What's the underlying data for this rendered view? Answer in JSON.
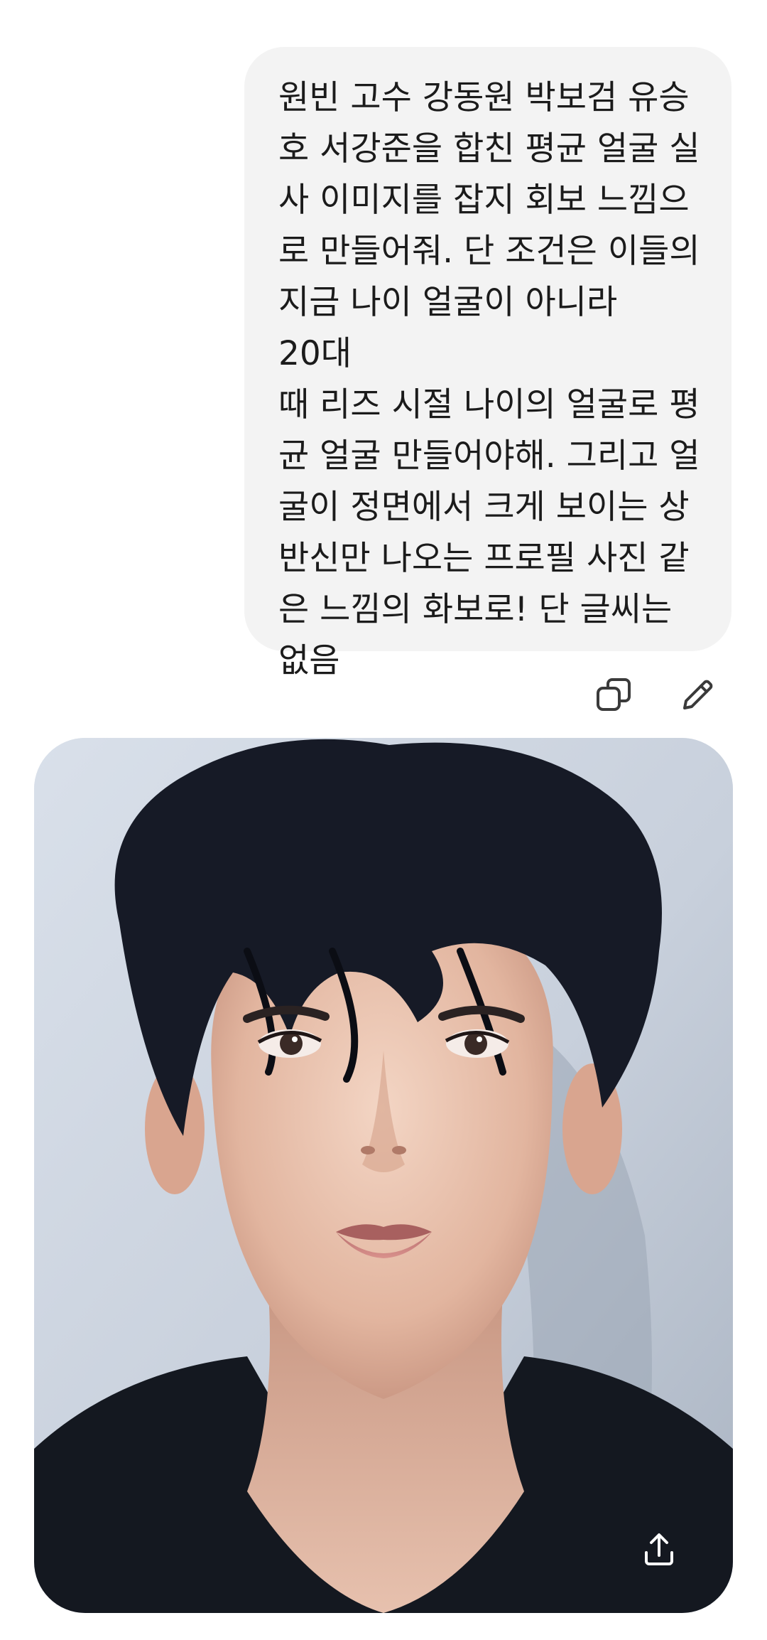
{
  "conversation": {
    "user_message": {
      "text": "원빈 고수 강동원 박보검 유승\n호 서강준을 합친 평균 얼굴 실\n사 이미지를 잡지 회보 느낌으\n로 만들어줘. 단 조건은 이들의\n지금 나이 얼굴이 아니라 20대\n때 리즈 시절 나이의 얼굴로 평\n균 얼굴 만들어야해. 그리고 얼\n굴이 정면에서 크게 보이는 상\n반신만 나오는 프로필 사진 같\n은 느낌의 화보로! 단 글씨는\n없음"
    },
    "message_actions": {
      "copy_icon": "copy-icon",
      "edit_icon": "pencil-icon"
    },
    "generated_image": {
      "subject": "portrait-photo",
      "share_icon": "share-upload-icon"
    }
  },
  "colors": {
    "background": "#ffffff",
    "bubble": "#f3f3f3",
    "text": "#1b1b1b",
    "icon": "#3a3a3a",
    "share_icon": "#ffffff"
  }
}
